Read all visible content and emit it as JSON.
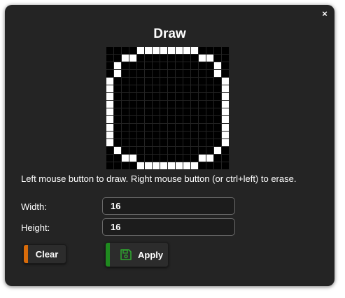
{
  "dialog": {
    "title": "Draw",
    "close_label": "×",
    "hint": "Left mouse button to draw. Right mouse button (or ctrl+left) to erase."
  },
  "grid": {
    "rows": [
      "0000111111110000",
      "0011000000001100",
      "0100000000000010",
      "0100000000000010",
      "1000000000000001",
      "1000000000000001",
      "1000000000000001",
      "1000000000000001",
      "1000000000000001",
      "1000000000000001",
      "1000000000000001",
      "1000000000000001",
      "1000000000000001",
      "0100000000000010",
      "0011000000001100",
      "0000111111110000"
    ],
    "on_color": "#ffffff",
    "off_color": "#000000"
  },
  "form": {
    "width_label": "Width:",
    "width_value": "16",
    "height_label": "Height:",
    "height_value": "16"
  },
  "buttons": {
    "clear_label": "Clear",
    "clear_accent": "#d86b0a",
    "apply_label": "Apply",
    "apply_accent": "#1f8a1f",
    "apply_icon": "floppy-disk-icon"
  }
}
